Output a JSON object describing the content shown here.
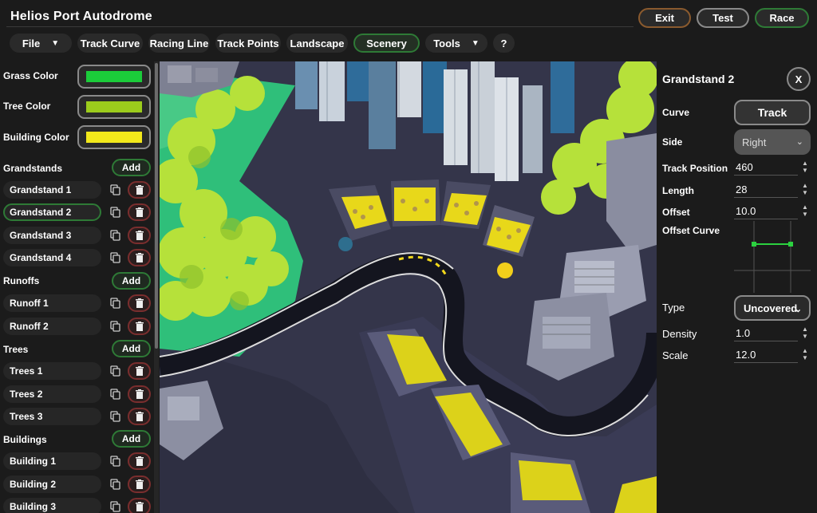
{
  "app": {
    "title": "Helios Port Autodrome"
  },
  "top_buttons": {
    "exit": "Exit",
    "test": "Test",
    "race": "Race"
  },
  "menu": {
    "file": "File",
    "track_curve": "Track Curve",
    "racing_line": "Racing Line",
    "track_points": "Track Points",
    "landscape": "Landscape",
    "scenery": "Scenery",
    "tools": "Tools",
    "help": "?",
    "active": "Scenery"
  },
  "colors": {
    "grass_label": "Grass Color",
    "grass": "#1bcc3a",
    "tree_label": "Tree Color",
    "tree": "#9ccc1c",
    "building_label": "Building Color",
    "building": "#f2e81b",
    "accent_green": "#2e7a36",
    "danger_red": "#7a2e2e"
  },
  "sections": {
    "grandstands": {
      "label": "Grandstands",
      "add": "Add",
      "items": [
        "Grandstand 1",
        "Grandstand 2",
        "Grandstand 3",
        "Grandstand 4"
      ],
      "selected": "Grandstand 2"
    },
    "runoffs": {
      "label": "Runoffs",
      "add": "Add",
      "items": [
        "Runoff 1",
        "Runoff 2"
      ]
    },
    "trees": {
      "label": "Trees",
      "add": "Add",
      "items": [
        "Trees 1",
        "Trees 2",
        "Trees 3"
      ]
    },
    "buildings": {
      "label": "Buildings",
      "add": "Add",
      "items": [
        "Building 1",
        "Building 2",
        "Building 3"
      ]
    }
  },
  "icons": {
    "copy": "copy-icon",
    "delete": "trash-icon",
    "chevron": "chevron-down-icon",
    "caret": "caret-down-icon"
  },
  "properties": {
    "title": "Grandstand 2",
    "close": "X",
    "curve_label": "Curve",
    "curve_value": "Track",
    "side_label": "Side",
    "side_value": "Right",
    "track_position_label": "Track Position",
    "track_position": "460",
    "length_label": "Length",
    "length": "28",
    "offset_label": "Offset",
    "offset": "10.0",
    "offset_curve_label": "Offset Curve",
    "type_label": "Type",
    "type_value": "Uncovered",
    "density_label": "Density",
    "density": "1.0",
    "scale_label": "Scale",
    "scale": "12.0"
  }
}
